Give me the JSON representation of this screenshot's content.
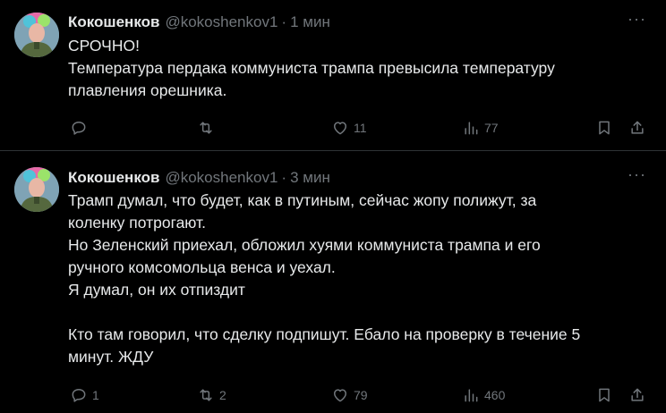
{
  "tweets": [
    {
      "author_name": "Кокошенков",
      "handle": "@kokoshenkov1",
      "separator": "·",
      "time": "1 мин",
      "more": "···",
      "lines": [
        "СРОЧНО!",
        "Температура пердака коммуниста трампа превысила температуру",
        "плавления орешника."
      ],
      "stats": {
        "replies": "",
        "retweets": "",
        "likes": "11",
        "views": "77"
      }
    },
    {
      "author_name": "Кокошенков",
      "handle": "@kokoshenkov1",
      "separator": "·",
      "time": "3 мин",
      "more": "···",
      "lines": [
        "Трамп думал, что будет, как в путиным, сейчас жопу полижут, за",
        "коленку потрогают.",
        "Но Зеленский приехал, обложил хуями коммуниста трампа и его",
        "ручного комсомольца венса и уехал.",
        "Я думал, он их отпиздит",
        "",
        "Кто там говорил, что сделку подпишут. Ебало на проверку в течение 5",
        "минут. ЖДУ"
      ],
      "stats": {
        "replies": "1",
        "retweets": "2",
        "likes": "79",
        "views": "460"
      }
    }
  ],
  "icons": {
    "reply": "reply-icon",
    "retweet": "retweet-icon",
    "like": "heart-icon",
    "views": "views-icon",
    "bookmark": "bookmark-icon",
    "share": "share-icon"
  },
  "colors": {
    "background": "#000000",
    "text": "#e7e9ea",
    "muted": "#71767b",
    "divider": "#2f3336"
  }
}
